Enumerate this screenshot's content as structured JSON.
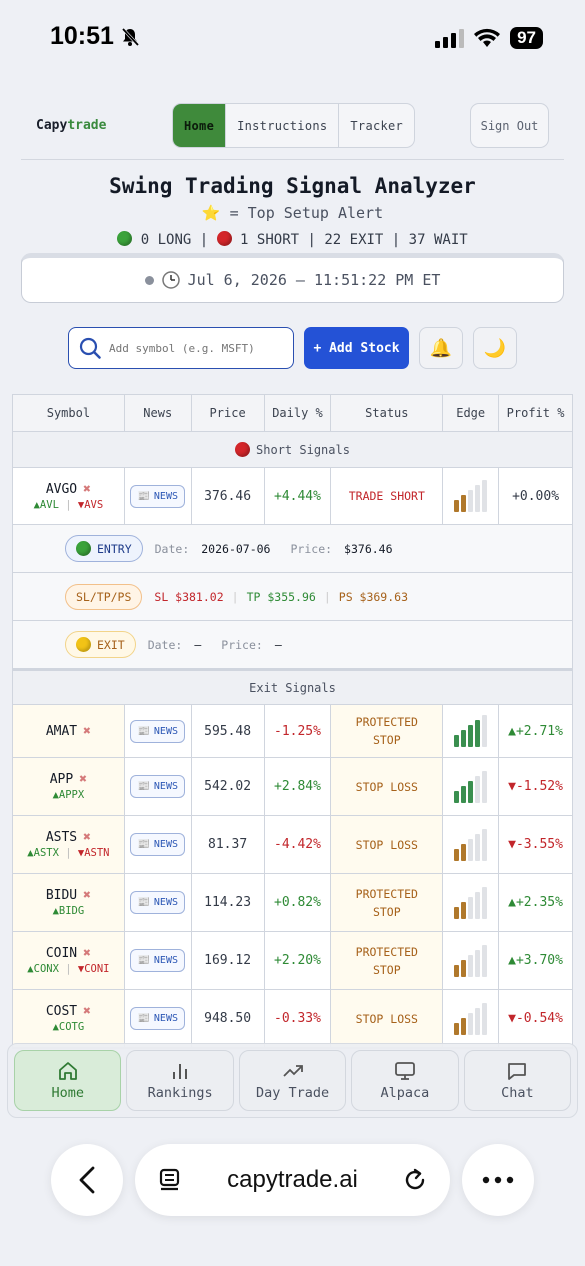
{
  "status_bar": {
    "time": "10:51",
    "battery": "97"
  },
  "header": {
    "brand_capy": "Capy",
    "brand_trade": "trade",
    "nav": [
      "Home",
      "Instructions",
      "Tracker"
    ],
    "sign_out": "Sign Out"
  },
  "title": "Swing Trading Signal Analyzer",
  "subtitle": "⭐ = Top Setup Alert",
  "counts": {
    "long": "0 LONG",
    "short": "1 SHORT",
    "exit": "22 EXIT",
    "wait": "37 WAIT"
  },
  "clock": "Jul 6, 2026 — 11:51:22 PM ET",
  "search": {
    "placeholder": "Add symbol (e.g. MSFT)"
  },
  "add_stock": "+ Add Stock",
  "table": {
    "headers": [
      "Symbol",
      "News",
      "Price",
      "Daily %",
      "Status",
      "Edge",
      "Profit %"
    ],
    "short_section": "Short Signals",
    "exit_section": "Exit Signals",
    "news_label": "NEWS",
    "avgo": {
      "symbol": "AVGO",
      "up_ticker": "▲AVL",
      "down_ticker": "▼AVS",
      "price": "376.46",
      "daily": "+4.44%",
      "status": "TRADE SHORT",
      "profit": "+0.00%",
      "edge": 2
    },
    "entry": {
      "label": "ENTRY",
      "date_label": "Date:",
      "date": "2026-07-06",
      "price_label": "Price:",
      "price": "$376.46"
    },
    "sltp": {
      "label": "SL/TP/PS",
      "sl": "SL $381.02",
      "tp": "TP $355.96",
      "ps": "PS $369.63"
    },
    "exit": {
      "label": "EXIT",
      "date_label": "Date:",
      "date": "—",
      "price_label": "Price:",
      "price": "—"
    },
    "rows": [
      {
        "symbol": "AMAT",
        "sub_up": "",
        "sub_down": "",
        "price": "595.48",
        "daily": "-1.25%",
        "status1": "PROTECTED",
        "status2": "STOP",
        "profit": "▲+2.71%",
        "edge": 4,
        "edge_color": "#3a8f4f"
      },
      {
        "symbol": "APP",
        "sub_up": "▲APPX",
        "sub_down": "",
        "price": "542.02",
        "daily": "+2.84%",
        "status1": "STOP LOSS",
        "status2": "",
        "profit": "▼-1.52%",
        "edge": 3,
        "edge_color": "#3a8f4f"
      },
      {
        "symbol": "ASTS",
        "sub_up": "▲ASTX",
        "sub_down": "▼ASTN",
        "price": "81.37",
        "daily": "-4.42%",
        "status1": "STOP LOSS",
        "status2": "",
        "profit": "▼-3.55%",
        "edge": 2,
        "edge_color": "#b0782b"
      },
      {
        "symbol": "BIDU",
        "sub_up": "▲BIDG",
        "sub_down": "",
        "price": "114.23",
        "daily": "+0.82%",
        "status1": "PROTECTED",
        "status2": "STOP",
        "profit": "▲+2.35%",
        "edge": 2,
        "edge_color": "#b0782b"
      },
      {
        "symbol": "COIN",
        "sub_up": "▲CONX",
        "sub_down": "▼CONI",
        "price": "169.12",
        "daily": "+2.20%",
        "status1": "PROTECTED",
        "status2": "STOP",
        "profit": "▲+3.70%",
        "edge": 2,
        "edge_color": "#b0782b"
      },
      {
        "symbol": "COST",
        "sub_up": "▲COTG",
        "sub_down": "",
        "price": "948.50",
        "daily": "-0.33%",
        "status1": "STOP LOSS",
        "status2": "",
        "profit": "▼-0.54%",
        "edge": 2,
        "edge_color": "#b0782b"
      }
    ]
  },
  "tabbar": [
    "Home",
    "Rankings",
    "Day Trade",
    "Alpaca",
    "Chat"
  ],
  "safari": {
    "url": "capytrade.ai"
  },
  "colors": {
    "accent_green": "#3f8a3b",
    "accent_blue": "#2452d6",
    "positive": "#2e8a35",
    "negative": "#c2262b"
  }
}
